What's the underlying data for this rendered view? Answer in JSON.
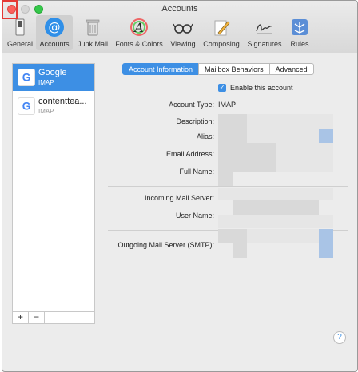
{
  "window": {
    "title": "Accounts"
  },
  "toolbar": {
    "items": [
      {
        "label": "General",
        "icon": "general-switch-icon"
      },
      {
        "label": "Accounts",
        "icon": "at-sign-icon"
      },
      {
        "label": "Junk Mail",
        "icon": "trash-bin-icon"
      },
      {
        "label": "Fonts & Colors",
        "icon": "fonts-colors-icon"
      },
      {
        "label": "Viewing",
        "icon": "glasses-icon"
      },
      {
        "label": "Composing",
        "icon": "pencil-icon"
      },
      {
        "label": "Signatures",
        "icon": "signature-icon"
      },
      {
        "label": "Rules",
        "icon": "rules-icon"
      }
    ],
    "selected": "Accounts"
  },
  "sidebar": {
    "accounts": [
      {
        "name": "Google",
        "type": "IMAP"
      },
      {
        "name": "contenttea...",
        "type": "IMAP"
      }
    ],
    "add_label": "+",
    "remove_label": "−"
  },
  "tabs": [
    {
      "label": "Account Information"
    },
    {
      "label": "Mailbox Behaviors"
    },
    {
      "label": "Advanced"
    }
  ],
  "account_info": {
    "enable_label": "Enable this account",
    "enable_checked": true,
    "account_type_label": "Account Type:",
    "account_type_value": "IMAP",
    "description_label": "Description:",
    "alias_label": "Alias:",
    "email_label": "Email Address:",
    "fullname_label": "Full Name:",
    "incoming_label": "Incoming Mail Server:",
    "username_label": "User Name:",
    "outgoing_label": "Outgoing Mail Server (SMTP):"
  },
  "help": {
    "label": "?"
  },
  "colors": {
    "accent": "#3d8fe4",
    "close": "#fc605c",
    "maximize": "#34c84a",
    "highlight": "#e53935"
  }
}
